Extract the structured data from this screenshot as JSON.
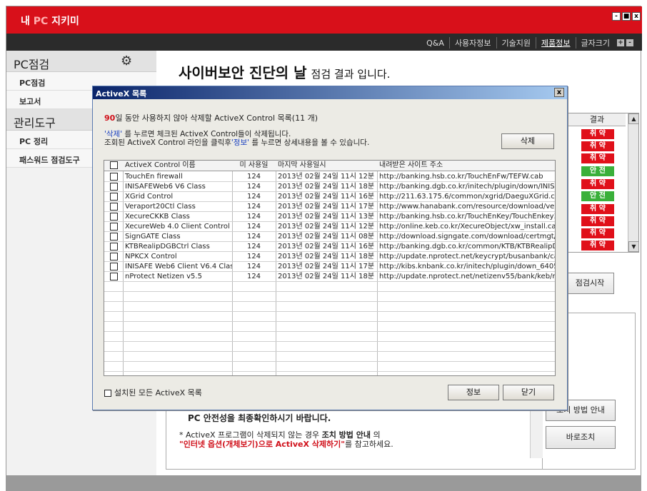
{
  "app": {
    "title_prefix": "내 ",
    "title_pc": "PC",
    "title_suffix": " 지키미",
    "window_controls": [
      "-",
      "■",
      "x"
    ]
  },
  "topnav": {
    "items": [
      "Q&A",
      "사용자정보",
      "기술지원",
      "제품정보",
      "글자크기"
    ],
    "size_plus": "+",
    "size_minus": "-"
  },
  "sidebar": {
    "section1": "PC점검",
    "items1": [
      "PC점검",
      "보고서"
    ],
    "section2": "관리도구",
    "items2": [
      "PC 정리",
      "패스워드 점검도구"
    ]
  },
  "main": {
    "heading": "사이버보안 진단의 날",
    "heading_sub": "점검 결과 입니다.",
    "results_header": "결과",
    "results": [
      "취 약",
      "취 약",
      "취 약",
      "안 전",
      "취 약",
      "안 전",
      "취 약",
      "취 약",
      "취 약",
      "취 약"
    ],
    "start_check_label": "점검시작",
    "guide_button_label": "조치 방법 안내",
    "fix_now_label": "바로조치",
    "info_line1": "PC 안전성을 최종확인하시기 바랍니다.",
    "info_line2_a": "* ActiveX 프로그램이 삭제되지 않는 경우 ",
    "info_line2_b": "조치 방법 안내",
    "info_line2_c": " 의",
    "info_line3_red": "\"인터넷 옵션(개체보기)으로 ActiveX 삭제하기\"",
    "info_line3_rest": "를 참고하세요."
  },
  "dialog": {
    "title": "ActiveX 목록",
    "close": "x",
    "msg_days": "90",
    "msg_rest": "일 동안 사용하지 않아 삭제할 ActiveX Control 목록(11 개)",
    "msg2_a1": "'삭제'",
    "msg2_a2": " 를 누르면 체크된 ActiveX Control들이 삭제됩니다.",
    "msg2_b1": "조회된 ActiveX Control 라인을 클릭후",
    "msg2_b2": "'정보'",
    "msg2_b3": " 를 누르면 상세내용을 볼 수 있습니다.",
    "delete_label": "삭제",
    "columns": [
      "ActiveX Control 이름",
      "미 사용일",
      "마지막 사용일시",
      "내려받은 사이트 주소"
    ],
    "rows": [
      {
        "name": "TouchEn firewall",
        "days": "124",
        "last": "2013년 02월 24일 11시 12분",
        "url": "http://banking.hsb.co.kr/TouchEnFw/TEFW.cab"
      },
      {
        "name": "INISAFEWeb6 V6 Class",
        "days": "124",
        "last": "2013년 02월 24일 11시 18분",
        "url": "http://banking.dgb.co.kr/initech/plugin/down/INIS60.cab"
      },
      {
        "name": "XGrid Control",
        "days": "124",
        "last": "2013년 02월 24일 11시 16분",
        "url": "http://211.63.175.6/common/xgrid/DaeguXGrid.cab"
      },
      {
        "name": "Veraport20Ctl Class",
        "days": "124",
        "last": "2013년 02월 24일 11시 17분",
        "url": "http://www.hanabank.com/resource/download/veraport/"
      },
      {
        "name": "XecureCKKB Class",
        "days": "124",
        "last": "2013년 02월 24일 11시 13분",
        "url": "http://banking.hsb.co.kr/TouchEnKey/TouchEnkey3107_3"
      },
      {
        "name": "XecureWeb 4.0 Client Control",
        "days": "124",
        "last": "2013년 02월 24일 11시 12분",
        "url": "http://online.keb.co.kr/XecureObject/xw_install.cab"
      },
      {
        "name": "SignGATE Class",
        "days": "124",
        "last": "2013년 02월 24일 11시 08분",
        "url": "http://download.signgate.com/download/certmgt/AxSignG"
      },
      {
        "name": "KTBRealipDGBCtrl Class",
        "days": "124",
        "last": "2013년 02월 24일 11시 16분",
        "url": "http://banking.dgb.co.kr/common/KTB/KTBRealipDGB.cab"
      },
      {
        "name": "NPKCX Control",
        "days": "124",
        "last": "2013년 02월 24일 11시 18분",
        "url": "http://update.nprotect.net/keycrypt/busanbank/cab/npkc"
      },
      {
        "name": "INISAFE Web6 Client V6.4  Class",
        "days": "124",
        "last": "2013년 02월 24일 11시 17분",
        "url": "http://kibs.knbank.co.kr/initech/plugin/down_64050/INIS6"
      },
      {
        "name": "nProtect Netizen v5.5",
        "days": "124",
        "last": "2013년 02월 24일 11시 18분",
        "url": "http://update.nprotect.net/netizenv55/bank/keb/npenkIE"
      }
    ],
    "show_all_label": "설치된 모든 ActiveX 목록",
    "info_label": "정보",
    "close_label": "닫기"
  },
  "colors": {
    "brand_red": "#d8101a",
    "bad": "#e0101a",
    "good": "#3ab03a",
    "dialog_title": "#0a246a"
  }
}
